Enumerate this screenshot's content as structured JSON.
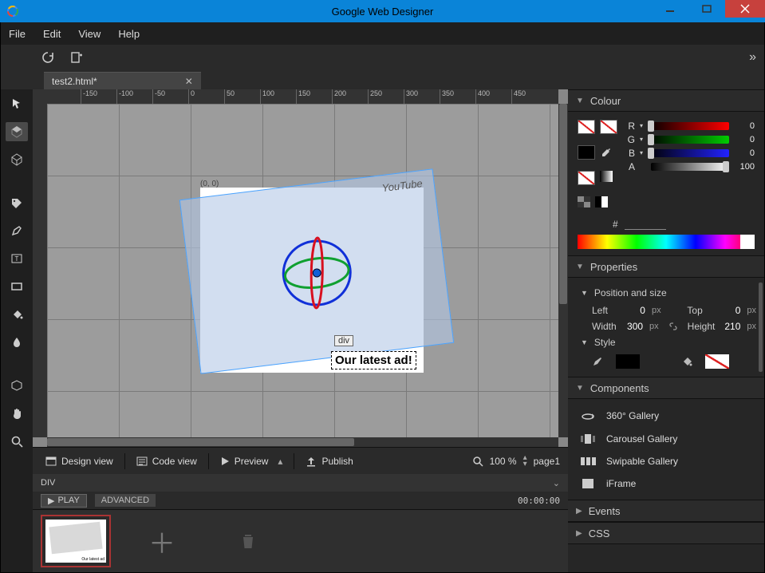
{
  "window": {
    "title": "Google Web Designer"
  },
  "menu": {
    "file": "File",
    "edit": "Edit",
    "view": "View",
    "help": "Help"
  },
  "tabs": {
    "active": "test2.html*"
  },
  "canvas": {
    "origin_label": "(0, 0)",
    "ruler_marks": [
      "-150",
      "-100",
      "-50",
      "0",
      "50",
      "100",
      "150",
      "200",
      "250",
      "300",
      "350",
      "400",
      "450"
    ],
    "yt_label": "YouTube",
    "element_tag": "div",
    "ad_text": "Our latest ad!"
  },
  "statusbar": {
    "design": "Design view",
    "code": "Code view",
    "preview": "Preview",
    "publish": "Publish",
    "zoom": "100 %",
    "page": "page1"
  },
  "breadcrumb": {
    "path": "DIV"
  },
  "playbar": {
    "play": "PLAY",
    "advanced": "ADVANCED",
    "time": "00:00:00"
  },
  "panels": {
    "colour": {
      "title": "Colour",
      "r_label": "R",
      "g_label": "G",
      "b_label": "B",
      "a_label": "A",
      "r": "0",
      "g": "0",
      "b": "0",
      "a": "100",
      "hash": "#"
    },
    "properties": {
      "title": "Properties",
      "pos_size": "Position and size",
      "left_l": "Left",
      "left_v": "0",
      "left_u": "px",
      "top_l": "Top",
      "top_v": "0",
      "top_u": "px",
      "width_l": "Width",
      "width_v": "300",
      "width_u": "px",
      "height_l": "Height",
      "height_v": "210",
      "height_u": "px",
      "style": "Style"
    },
    "components": {
      "title": "Components",
      "items": [
        "360° Gallery",
        "Carousel Gallery",
        "Swipable Gallery",
        "iFrame"
      ]
    },
    "events": {
      "title": "Events"
    },
    "css": {
      "title": "CSS"
    }
  }
}
